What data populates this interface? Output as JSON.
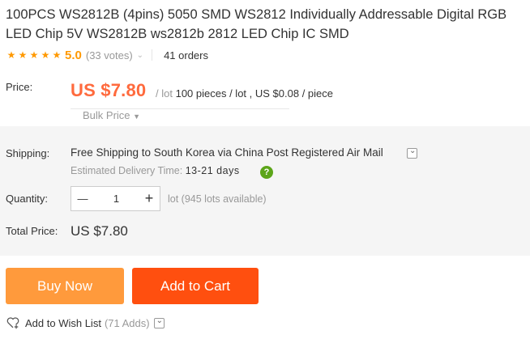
{
  "product": {
    "title": "100PCS WS2812B (4pins) 5050 SMD WS2812 Individually Addressable Digital RGB LED Chip 5V WS2812B ws2812b 2812 LED Chip IC SMD"
  },
  "rating": {
    "stars": 5,
    "score": "5.0",
    "votes": "(33 votes)",
    "orders": "41 orders",
    "star_glyph": "★"
  },
  "price": {
    "label": "Price:",
    "value": "US $7.80",
    "per_lot_prefix": "/ lot",
    "per_lot_detail": "100 pieces / lot , US $0.08 / piece",
    "bulk_label": "Bulk Price"
  },
  "shipping": {
    "label": "Shipping:",
    "text": "Free Shipping to South Korea via China Post Registered Air Mail",
    "delivery_label": "Estimated Delivery Time:",
    "delivery_days": "13-21 days",
    "help_glyph": "?"
  },
  "quantity": {
    "label": "Quantity:",
    "value": "1",
    "minus": "—",
    "plus": "+",
    "available": "lot (945 lots available)"
  },
  "total": {
    "label": "Total Price:",
    "value": "US $7.80"
  },
  "buttons": {
    "buy_now": "Buy Now",
    "add_to_cart": "Add to Cart"
  },
  "wishlist": {
    "label": "Add to Wish List",
    "adds": "(71 Adds)"
  },
  "colors": {
    "accent_orange": "#ff6a3d",
    "buy_now_bg": "#ff9a3c",
    "add_to_cart_bg": "#ff4f0f",
    "star": "#ff9900",
    "help_green": "#5ca519"
  }
}
